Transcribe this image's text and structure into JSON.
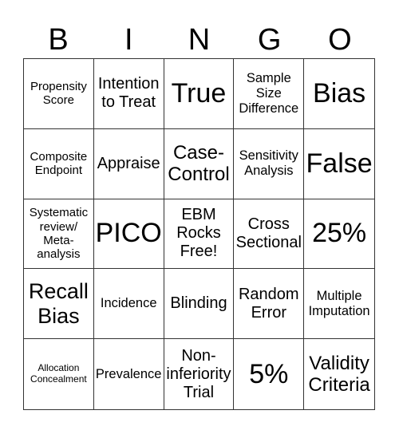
{
  "header": [
    "B",
    "I",
    "N",
    "G",
    "O"
  ],
  "cells": [
    {
      "text": "Propensity Score",
      "size": "s14"
    },
    {
      "text": "Intention to Treat",
      "size": "s20"
    },
    {
      "text": "True",
      "size": "s34"
    },
    {
      "text": "Sample Size Difference",
      "size": "s16"
    },
    {
      "text": "Bias",
      "size": "s34"
    },
    {
      "text": "Composite Endpoint",
      "size": "s14"
    },
    {
      "text": "Appraise",
      "size": "s20"
    },
    {
      "text": "Case-Control",
      "size": "s24"
    },
    {
      "text": "Sensitivity Analysis",
      "size": "s16"
    },
    {
      "text": "False",
      "size": "s34"
    },
    {
      "text": "Systematic review/ Meta-analysis",
      "size": "s14"
    },
    {
      "text": "PICO",
      "size": "s34"
    },
    {
      "text": "EBM Rocks Free!",
      "size": "s20"
    },
    {
      "text": "Cross Sectional",
      "size": "s20"
    },
    {
      "text": "25%",
      "size": "s34"
    },
    {
      "text": "Recall Bias",
      "size": "s28"
    },
    {
      "text": "Incidence",
      "size": "s16"
    },
    {
      "text": "Blinding",
      "size": "s20"
    },
    {
      "text": "Random Error",
      "size": "s20"
    },
    {
      "text": "Multiple Imputation",
      "size": "s16"
    },
    {
      "text": "Allocation Concealment",
      "size": "s12"
    },
    {
      "text": "Prevalence",
      "size": "s16"
    },
    {
      "text": "Non-inferiority Trial",
      "size": "s20"
    },
    {
      "text": "5%",
      "size": "s34"
    },
    {
      "text": "Validity Criteria",
      "size": "s24"
    }
  ]
}
